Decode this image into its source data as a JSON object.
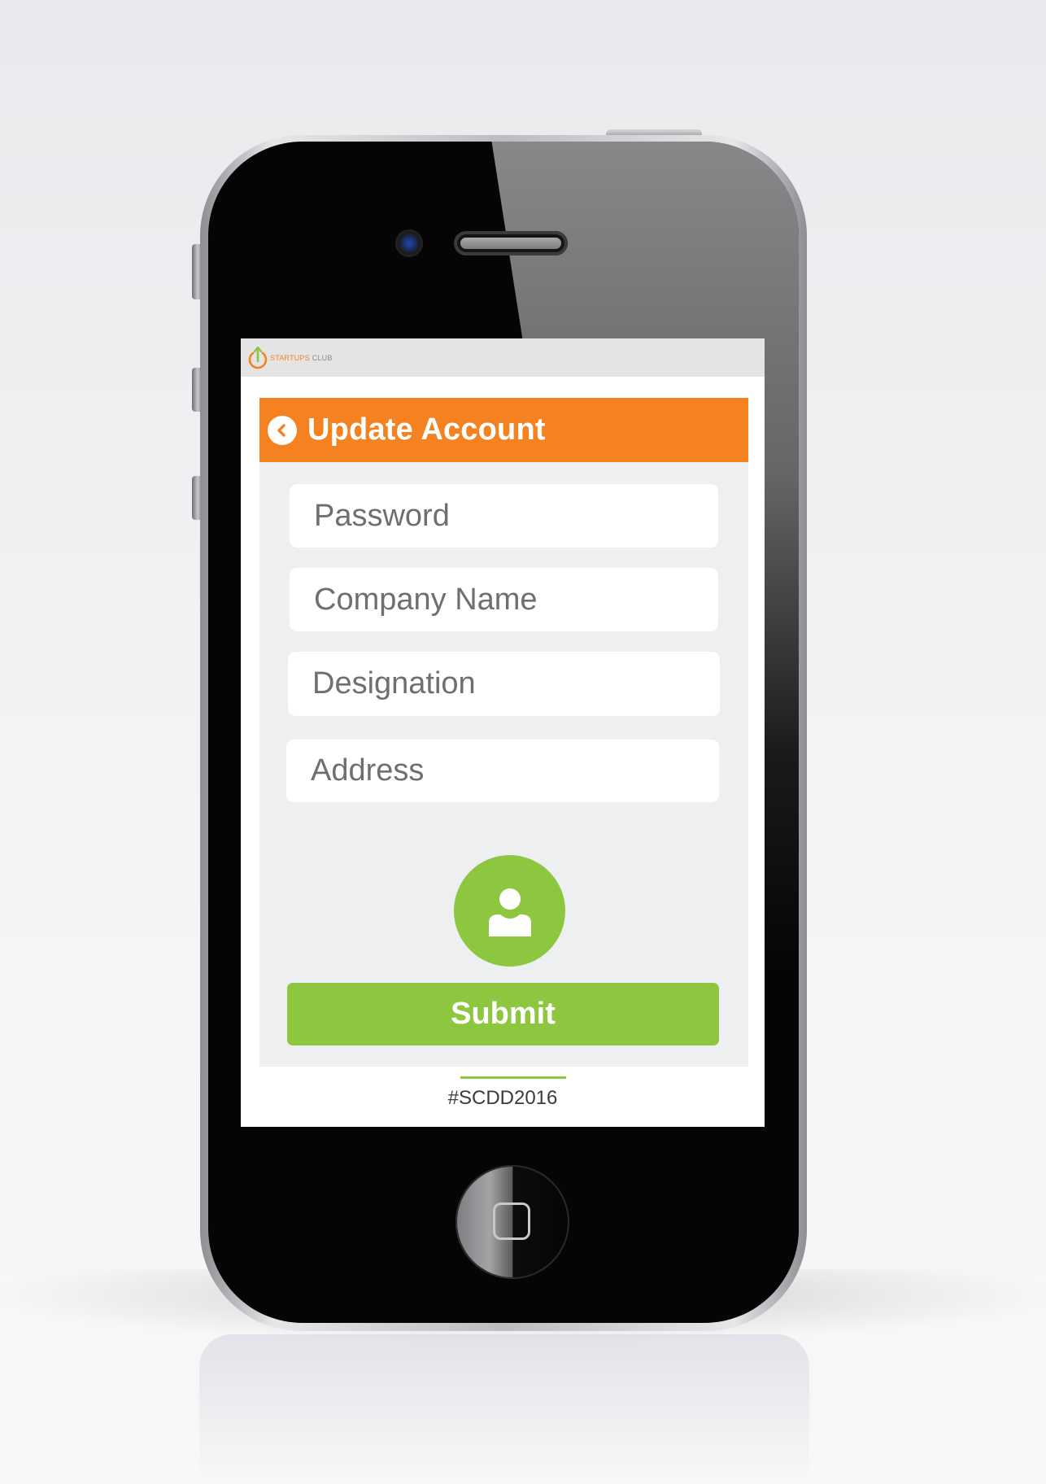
{
  "app": {
    "logo_name": "STARTUPS",
    "logo_suffix": "CLUB"
  },
  "header": {
    "title": "Update Account",
    "back_icon": "chevron-left-circle-icon"
  },
  "form": {
    "fields": [
      {
        "placeholder": "Password",
        "value": ""
      },
      {
        "placeholder": "Company Name",
        "value": ""
      },
      {
        "placeholder": "Designation",
        "value": ""
      },
      {
        "placeholder": "Address",
        "value": ""
      }
    ],
    "avatar_icon": "user-icon",
    "submit_label": "Submit"
  },
  "footer": {
    "hashtag": "#SCDD2016"
  },
  "colors": {
    "brand_orange": "#f58220",
    "accent_green": "#8dc63f",
    "panel_bg": "#edeff1",
    "logo_bar_bg": "#e4e4e4"
  }
}
